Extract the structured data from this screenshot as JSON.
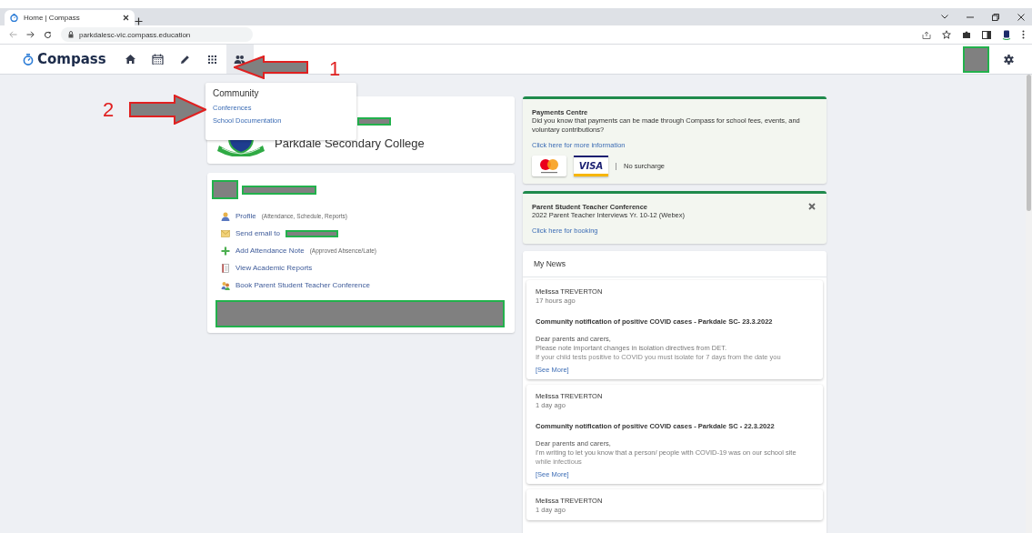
{
  "browser": {
    "tab_title": "Home | Compass",
    "url": "parkdalesc-vic.compass.education"
  },
  "nav": {
    "logo": "Compass",
    "icons": [
      {
        "kind": "home",
        "selected": false
      },
      {
        "kind": "calendar",
        "selected": false
      },
      {
        "kind": "pencil",
        "selected": false
      },
      {
        "kind": "grid",
        "selected": false
      },
      {
        "kind": "people",
        "selected": true
      }
    ]
  },
  "dropdown": {
    "title": "Community",
    "items": [
      "Conferences",
      "School Documentation"
    ]
  },
  "annotations": [
    {
      "label": "1"
    },
    {
      "label": "2"
    }
  ],
  "school_card": {
    "name": "Parkdale Secondary College"
  },
  "student_card": {
    "links": [
      {
        "kind": "profile",
        "text": "Profile",
        "note": "(Attendance, Schedule, Reports)"
      },
      {
        "kind": "email",
        "text": "Send email to"
      },
      {
        "kind": "plus",
        "text": "Add Attendance Note",
        "note": "(Approved Absence/Late)"
      },
      {
        "kind": "report",
        "text": "View Academic Reports"
      },
      {
        "kind": "conference",
        "text": "Book Parent Student Teacher Conference"
      }
    ]
  },
  "payments": {
    "title": "Payments Centre",
    "text": "Did you know that payments can be made through Compass for school fees, events, and voluntary contributions?",
    "link": "Click here for more information",
    "visa": "VISA",
    "note": "No surcharge"
  },
  "conference": {
    "title": "Parent Student Teacher Conference",
    "text": "2022 Parent Teacher Interviews Yr. 10-12 (Webex)",
    "link": "Click here for booking"
  },
  "news": {
    "title": "My News",
    "items": [
      {
        "author": "Melissa TREVERTON",
        "time": "17 hours ago",
        "headline": "Community notification of positive COVID cases - Parkdale SC- 23.3.2022",
        "body": [
          "Dear parents and carers,",
          "Please note important changes in isolation directives from DET.",
          "If your child tests positive to COVID you must isolate for 7 days from the date you"
        ],
        "see_more": "[See More]"
      },
      {
        "author": "Melissa TREVERTON",
        "time": "1 day ago",
        "headline": "Community notification of positive COVID cases - Parkdale SC - 22.3.2022",
        "body": [
          "Dear parents and carers,",
          "I'm writing to let you know that a person/ people with COVID-19 was on our school site",
          "while infectious"
        ],
        "see_more": "[See More]"
      },
      {
        "author": "Melissa TREVERTON",
        "time": "1 day ago"
      }
    ]
  }
}
